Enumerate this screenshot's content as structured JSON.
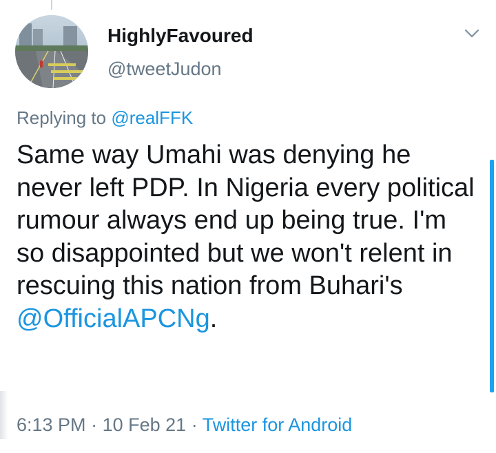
{
  "tweet": {
    "author": {
      "display_name": "HighlyFavoured",
      "handle": "@tweetJudon",
      "avatar_icon": "road-photo-avatar"
    },
    "reply_prefix": "Replying to",
    "reply_to": "@realFFK",
    "text_plain": "Same way Umahi was denying he never left PDP. In Nigeria every political rumour always end up being true. I'm so disappointed but we won't relent in rescuing this nation from Buhari's",
    "text_mention": "@OfficialAPCNg",
    "text_suffix": ".",
    "time": "6:13 PM",
    "date": "10 Feb 21",
    "separator": "·",
    "source": "Twitter for Android"
  },
  "colors": {
    "text": "#14171a",
    "secondary": "#657786",
    "link": "#1b95e0",
    "accent": "#1da1f2"
  },
  "icons": {
    "menu": "chevron-down-icon"
  }
}
